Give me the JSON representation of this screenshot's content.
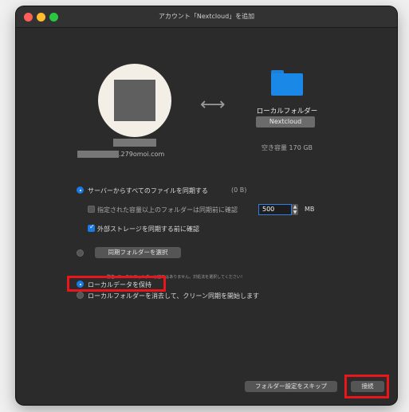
{
  "window": {
    "title": "アカウント「Nextcloud」を追加"
  },
  "account": {
    "email_suffix": ".279omoi.com"
  },
  "local_folder": {
    "label": "ローカルフォルダー",
    "name": "Nextcloud",
    "free_space": "空き容量 170 GB"
  },
  "sync": {
    "option_all_label": "サーバーからすべてのファイルを同期する",
    "option_all_size": "(0 B)",
    "ask_large_label": "指定された容量以上のフォルダーは同期前に確認",
    "size_limit_value": "500",
    "size_unit": "MB",
    "ask_external_label": "外部ストレージを同期する前に確認",
    "choose_folders_button": "同期フォルダーを選択",
    "warning_note": "警告: ローカルフォルダーは空ではありません。対処法を選択してください！",
    "keep_local_label": "ローカルデータを保持",
    "clean_sync_label": "ローカルフォルダーを消去して、クリーン同期を開始します"
  },
  "buttons": {
    "skip_label": "フォルダー設定をスキップ",
    "connect_label": "接続"
  },
  "colors": {
    "accent": "#1a7ae6",
    "highlight": "#e8161b"
  }
}
